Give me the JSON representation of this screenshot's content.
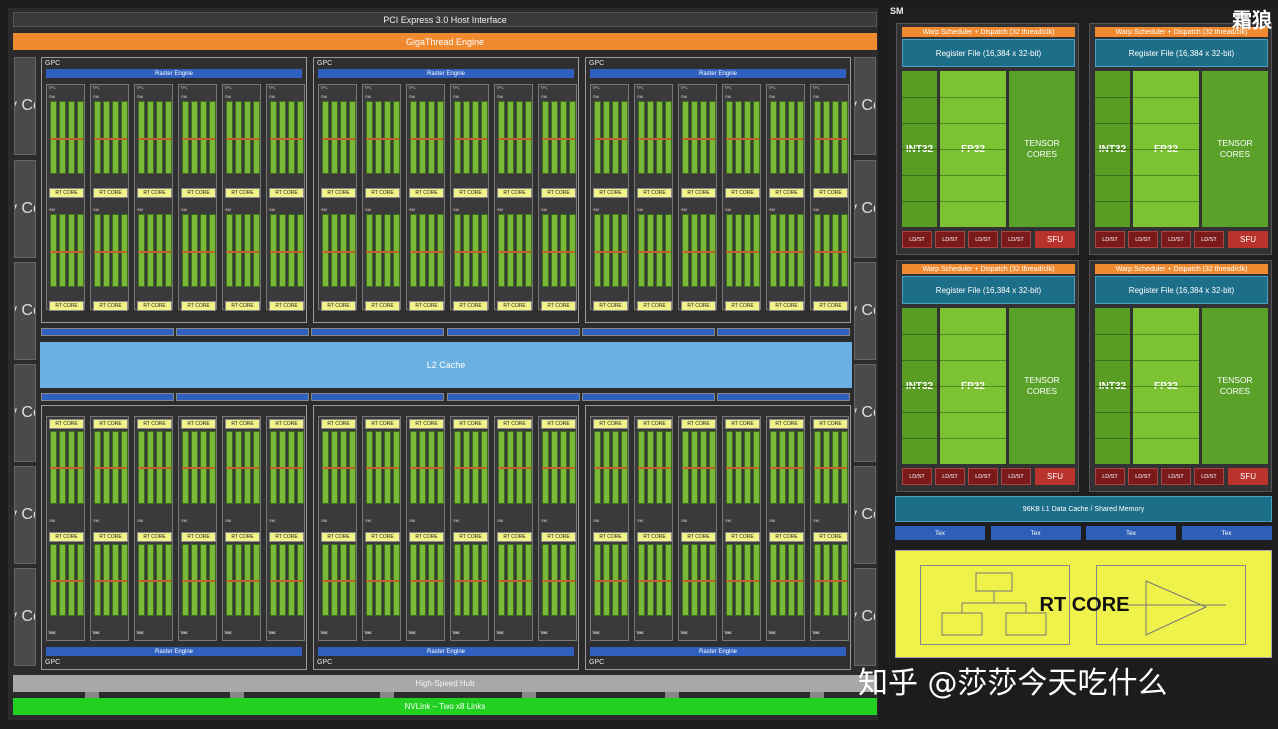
{
  "gpu": {
    "pcie": "PCI Express 3.0 Host Interface",
    "gigathread": "GigaThread Engine",
    "memory_controller": "Memory Controller",
    "memory_controller_count_per_side": 6,
    "gpc_label": "GPC",
    "raster_engine": "Raster Engine",
    "tpc_label": "TPC",
    "polymorph": "PolyMorph Engine",
    "sm_label": "SM",
    "rt_core_small": "RT CORE",
    "l2_cache": "L2 Cache",
    "high_speed_hub": "High-Speed Hub",
    "nvlink": "NVLink – Two x8 Links"
  },
  "sm": {
    "title": "SM",
    "warp_scheduler": "Warp Scheduler + Dispatch (32 thread/clk)",
    "register_file": "Register File (16,384 x 32-bit)",
    "int32": "INT32",
    "fp32": "FP32",
    "tensor_cores": "TENSOR CORES",
    "ldst": "LD/ST",
    "sfu": "SFU",
    "l1_cache": "96KB L1 Data Cache / Shared Memory",
    "tex": "Tex",
    "rt_core": "RT CORE"
  },
  "watermark": {
    "top_right": "霜狼",
    "bottom": "知乎 @莎莎今天吃什么"
  },
  "colors": {
    "gigathread": "#f08a30",
    "raster": "#2f5fbf",
    "l2": "#6ab0e0",
    "nvlink": "#22d022",
    "rt_core": "#eef24a",
    "int32": "#5a9d25",
    "fp32": "#7cc232",
    "tensor": "#5aa129",
    "register_file": "#1d6e88",
    "sfu": "#b8332b"
  }
}
